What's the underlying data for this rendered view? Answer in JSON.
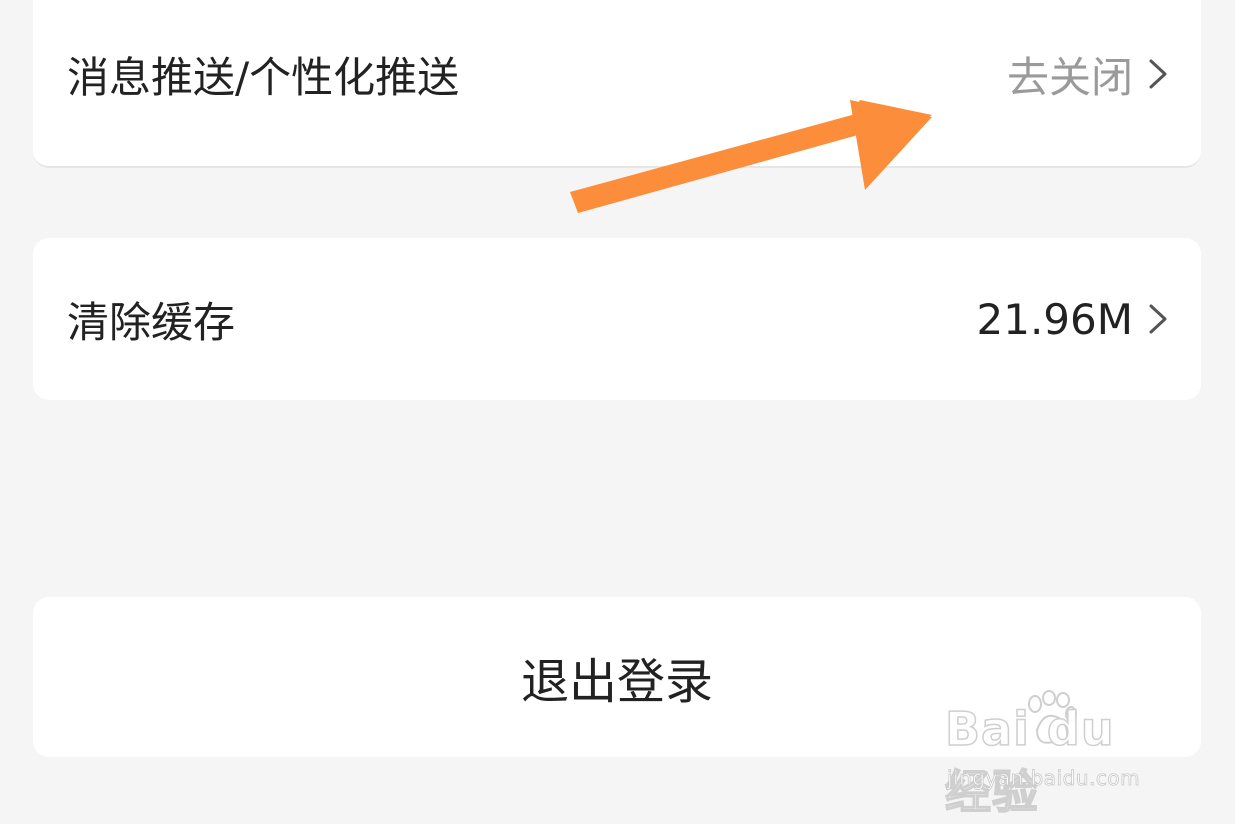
{
  "settings": {
    "push": {
      "label": "消息推送/个性化推送",
      "value": "去关闭",
      "value_color": "#9a9a9a"
    },
    "cache": {
      "label": "清除缓存",
      "value": "21.96M",
      "value_color": "#222222"
    },
    "logout": {
      "label": "退出登录"
    }
  },
  "annotation": {
    "arrow_color": "#fc8d3b",
    "icon": "pointer-arrow"
  },
  "watermark": {
    "brand": "Bai du 经验",
    "url": "jingyan.baidu.com"
  },
  "colors": {
    "background": "#f5f5f5",
    "card": "#ffffff",
    "text": "#222222",
    "muted": "#9a9a9a"
  }
}
